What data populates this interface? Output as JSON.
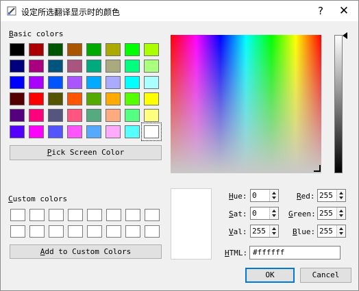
{
  "window": {
    "title": "设定所选翻译显示时的颜色",
    "help_glyph": "?",
    "close_glyph": "✕"
  },
  "basic_colors": {
    "label_first": "B",
    "label_rest": "asic colors",
    "swatches": [
      "#000000",
      "#aa0000",
      "#005500",
      "#aa5500",
      "#00aa00",
      "#aaaa00",
      "#00ff00",
      "#aaff00",
      "#00007f",
      "#aa007f",
      "#00557f",
      "#aa557f",
      "#00aa7f",
      "#aaaa7f",
      "#00ff7f",
      "#aaff7f",
      "#0000ff",
      "#aa00ff",
      "#0055ff",
      "#aa55ff",
      "#00aaff",
      "#aaaaff",
      "#00ffff",
      "#aaffff",
      "#550000",
      "#ff0000",
      "#555500",
      "#ff5500",
      "#55aa00",
      "#ffaa00",
      "#55ff00",
      "#ffff00",
      "#55007f",
      "#ff007f",
      "#55557f",
      "#ff557f",
      "#55aa7f",
      "#ffaa7f",
      "#55ff7f",
      "#ffff7f",
      "#5500ff",
      "#ff00ff",
      "#5555ff",
      "#ff55ff",
      "#55aaff",
      "#ffaaff",
      "#55ffff",
      "#ffffff"
    ],
    "selected_index": 47
  },
  "pick_screen": {
    "first": "P",
    "rest": "ick Screen Color"
  },
  "custom_colors": {
    "label_first": "C",
    "label_rest": "ustom colors",
    "count": 16
  },
  "add_custom": {
    "first": "A",
    "rest": "dd to Custom Colors"
  },
  "fields": {
    "hue": {
      "label_first": "H",
      "label_rest": "ue:",
      "value": "0"
    },
    "sat": {
      "label_first": "S",
      "label_rest": "at:",
      "value": "0"
    },
    "val": {
      "label_first": "V",
      "label_rest": "al:",
      "value": "255"
    },
    "red": {
      "label_first": "R",
      "label_rest": "ed:",
      "value": "255"
    },
    "green": {
      "label_first": "G",
      "label_rest": "reen:",
      "value": "255"
    },
    "blue": {
      "label_first": "B",
      "label_rest": "lue:",
      "value": "255"
    },
    "html": {
      "label_first": "H",
      "label_rest": "TML:",
      "value": "#ffffff"
    }
  },
  "buttons": {
    "ok": "OK",
    "cancel": "Cancel"
  },
  "current_color": "#ffffff"
}
